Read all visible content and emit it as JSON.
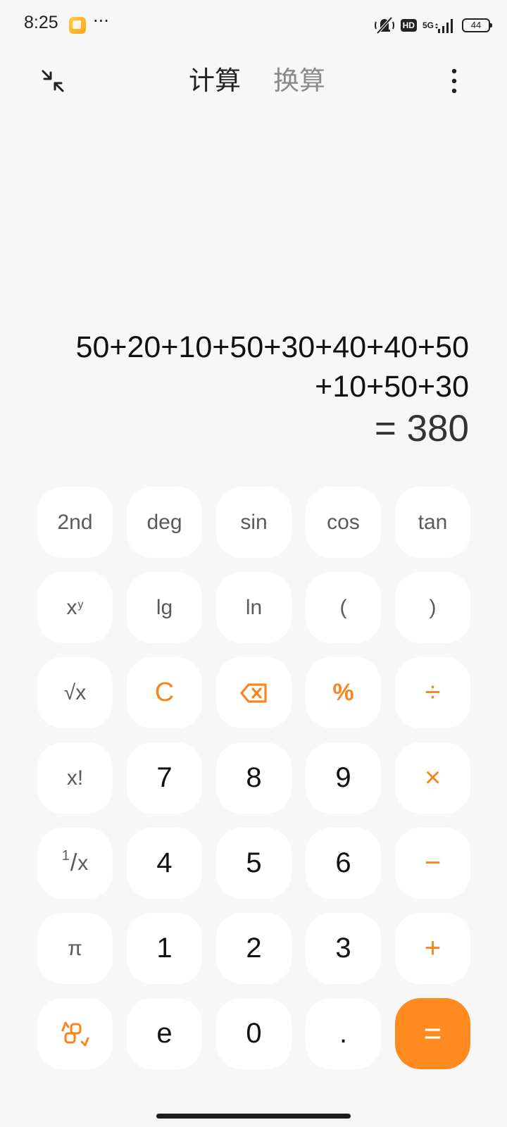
{
  "status_bar": {
    "time": "8:25",
    "more": "···",
    "hd": "HD",
    "network": "5G",
    "battery": "44"
  },
  "header": {
    "tabs": [
      {
        "label": "计算",
        "active": true
      },
      {
        "label": "换算",
        "active": false
      }
    ]
  },
  "display": {
    "expression_lines": [
      "50+20+10+50+30+40+40+50",
      "+10+50+30"
    ],
    "result": "= 380"
  },
  "keys": {
    "second": "2nd",
    "deg": "deg",
    "sin": "sin",
    "cos": "cos",
    "tan": "tan",
    "power_base": "x",
    "power_exp": "y",
    "lg": "lg",
    "ln": "ln",
    "paren_open": "(",
    "paren_close": ")",
    "sqrt": "√x",
    "clear": "C",
    "percent": "%",
    "divide": "÷",
    "factorial": "x!",
    "seven": "7",
    "eight": "8",
    "nine": "9",
    "multiply": "×",
    "recip_num": "1",
    "recip_slash": "/",
    "recip_den": "x",
    "four": "4",
    "five": "5",
    "six": "6",
    "minus": "−",
    "pi": "π",
    "one": "1",
    "two": "2",
    "three": "3",
    "plus": "+",
    "e": "e",
    "zero": "0",
    "dot": ".",
    "equals": "="
  },
  "colors": {
    "accent": "#f7861c",
    "equals_bg": "#ff8a1f",
    "background": "#f7f7f7",
    "key_bg": "#ffffff"
  },
  "icons": {
    "collapse": "collapse-arrows-icon",
    "menu": "more-vertical-icon",
    "backspace": "backspace-icon",
    "switch": "switch-mode-icon",
    "mute": "vibrate-mute-icon",
    "signal": "signal-icon"
  }
}
